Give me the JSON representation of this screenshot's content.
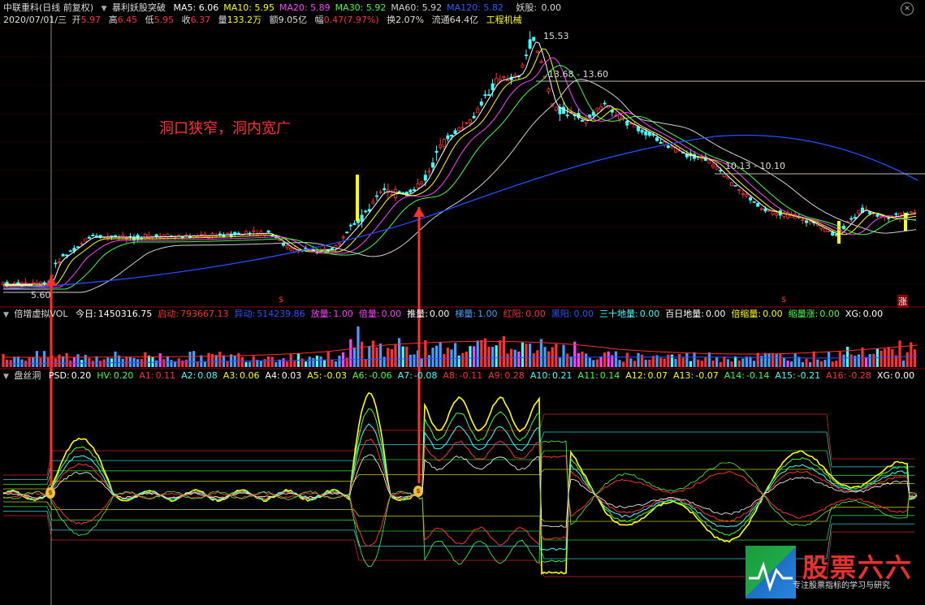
{
  "header": {
    "stock": "中联重科(日线 前复权)",
    "formula": "暴利妖股突破",
    "ma": [
      {
        "label": "MA5:",
        "value": "6.06",
        "color": "#ffffff"
      },
      {
        "label": "MA10:",
        "value": "5.95",
        "color": "#ffff00"
      },
      {
        "label": "MA20:",
        "value": "5.89",
        "color": "#ff40ff"
      },
      {
        "label": "MA30:",
        "value": "5.92",
        "color": "#40ff40"
      },
      {
        "label": "MA60:",
        "value": "5.92",
        "color": "#d0d0d0"
      },
      {
        "label": "MA120:",
        "value": "5.82",
        "color": "#2060ff"
      }
    ],
    "yao_label": "妖股:",
    "yao_value": "0.00"
  },
  "quote": {
    "date": "2020/07/01/三",
    "open_label": "开",
    "open": "5.97",
    "high_label": "高",
    "high": "6.45",
    "low_label": "低",
    "low": "5.95",
    "close_label": "收",
    "close": "6.37",
    "vol_label": "量",
    "vol": "133.2万",
    "amt_label": "额",
    "amt": "9.05亿",
    "chg_label": "幅",
    "chg": "0.47(7.97%)",
    "turn_label": "换",
    "turn": "2.07%",
    "float_label": "流通",
    "float": "64.4亿",
    "sector": "工程机械"
  },
  "price_chart": {
    "annotation": "洞口狭窄，洞内宽广",
    "high_label": "15.53",
    "level1": "13.68 - 13.60",
    "level2": "10.13 - 10.10",
    "low_label": "5.60",
    "rise_tag": "涨",
    "signal_mark": "$"
  },
  "vol_panel": {
    "title": "倍增虚拟VOL",
    "items": [
      {
        "label": "今日:",
        "value": "1450316.75",
        "color": "#ffffff"
      },
      {
        "label": "启动:",
        "value": "793667.13",
        "color": "#ff3030"
      },
      {
        "label": "异动:",
        "value": "514239.86",
        "color": "#3050ff"
      },
      {
        "label": "放量:",
        "value": "1.00",
        "color": "#ff40ff"
      },
      {
        "label": "倍量:",
        "value": "0.00",
        "color": "#ff40ff"
      },
      {
        "label": "推量:",
        "value": "0.00",
        "color": "#ffffff"
      },
      {
        "label": "梯量:",
        "value": "1.00",
        "color": "#40a0ff"
      },
      {
        "label": "红阳:",
        "value": "0.00",
        "color": "#ff3030"
      },
      {
        "label": "黑阳:",
        "value": "0.00",
        "color": "#3050ff"
      },
      {
        "label": "三十地量:",
        "value": "0.00",
        "color": "#40ffff"
      },
      {
        "label": "百日地量:",
        "value": "0.00",
        "color": "#ffffff"
      },
      {
        "label": "倍缩量:",
        "value": "0.00",
        "color": "#ffff00"
      },
      {
        "label": "缩量涨:",
        "value": "0.00",
        "color": "#40ff40"
      },
      {
        "label": "XG:",
        "value": "0.00",
        "color": "#ffffff"
      }
    ]
  },
  "psd_panel": {
    "title": "盘丝洞",
    "items": [
      {
        "label": "PSD:",
        "value": "0.20",
        "color": "#ffffff"
      },
      {
        "label": "HV:",
        "value": "0.20",
        "color": "#40ff40"
      },
      {
        "label": "A1:",
        "value": "0.11",
        "color": "#ff3030"
      },
      {
        "label": "A2:",
        "value": "0.08",
        "color": "#40ffff"
      },
      {
        "label": "A3:",
        "value": "0.06",
        "color": "#ffff00"
      },
      {
        "label": "A4:",
        "value": "0.03",
        "color": "#ffffff"
      },
      {
        "label": "A5:",
        "value": "-0.03",
        "color": "#ffff00"
      },
      {
        "label": "A6:",
        "value": "-0.06",
        "color": "#40ff40"
      },
      {
        "label": "A7:",
        "value": "-0.08",
        "color": "#40ffff"
      },
      {
        "label": "A8:",
        "value": "-0.11",
        "color": "#ff3030"
      },
      {
        "label": "A9:",
        "value": "0.28",
        "color": "#ff3030"
      },
      {
        "label": "A10:",
        "value": "0.21",
        "color": "#40ffff"
      },
      {
        "label": "A11:",
        "value": "0.14",
        "color": "#40ff40"
      },
      {
        "label": "A12:",
        "value": "0.07",
        "color": "#ffff00"
      },
      {
        "label": "A13:",
        "value": "-0.07",
        "color": "#ffff00"
      },
      {
        "label": "A14:",
        "value": "-0.14",
        "color": "#40ff40"
      },
      {
        "label": "A15:",
        "value": "-0.21",
        "color": "#40ffff"
      },
      {
        "label": "A16:",
        "value": "-0.28",
        "color": "#ff3030"
      },
      {
        "label": "XG:",
        "value": "0.00",
        "color": "#ffffff"
      }
    ]
  },
  "watermark": {
    "brand": "股票六六",
    "slogan": "专注股票指标的学习与研究"
  }
}
